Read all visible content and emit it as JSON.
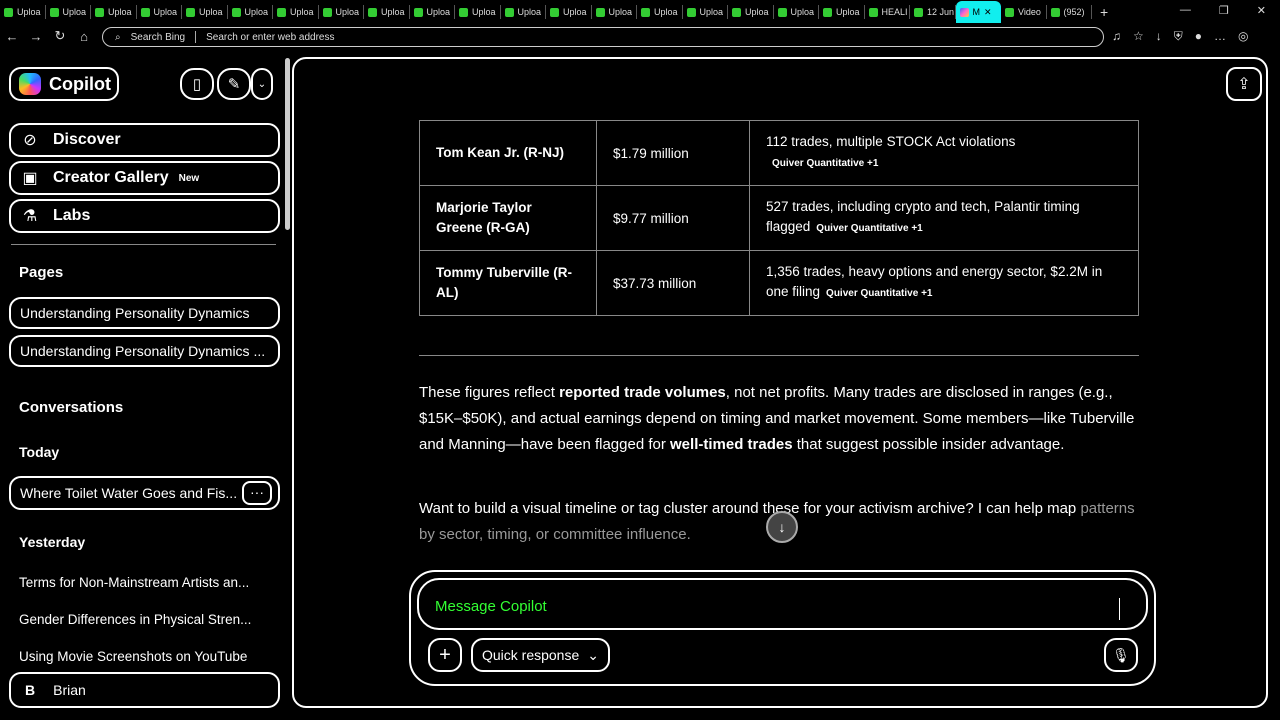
{
  "browser": {
    "tabs": [
      "Uploa",
      "Uploa",
      "Uploa",
      "Uploa",
      "Uploa",
      "Uploa",
      "Uploa",
      "Uploa",
      "Uploa",
      "Uploa",
      "Uploa",
      "Uploa",
      "Uploa",
      "Uploa",
      "Uploa",
      "Uploa",
      "Uploa",
      "Uploa",
      "Uploa",
      "HEALI",
      "12 Jun",
      "M",
      "Video",
      "(952)"
    ],
    "new_tab": "+",
    "search_label": "Search Bing",
    "address_placeholder": "Search or enter web address"
  },
  "sidebar": {
    "brand": "Copilot",
    "nav": [
      {
        "label": "Discover"
      },
      {
        "label": "Creator Gallery",
        "badge": "New"
      },
      {
        "label": "Labs"
      }
    ],
    "pages_heading": "Pages",
    "pages": [
      "Understanding Personality Dynamics",
      "Understanding Personality Dynamics ..."
    ],
    "conversations_heading": "Conversations",
    "today": "Today",
    "today_items": [
      "Where Toilet Water Goes and Fis..."
    ],
    "more": "···",
    "yesterday": "Yesterday",
    "yesterday_items": [
      "Terms for Non-Mainstream Artists an...",
      "Gender Differences in Physical Stren...",
      "Using Movie Screenshots on YouTube"
    ],
    "user": {
      "initial": "B",
      "name": "Brian"
    }
  },
  "table": {
    "rows": [
      {
        "name": "Tom Kean Jr. (R-NJ)",
        "value": "$1.79 million",
        "note": "112 trades, multiple STOCK Act violations",
        "source": "Quiver Quantitative +1"
      },
      {
        "name": "Marjorie Taylor Greene (R-GA)",
        "value": "$9.77 million",
        "note": "527 trades, including crypto and tech, Palantir timing flagged",
        "source": "Quiver Quantitative +1"
      },
      {
        "name": "Tommy Tuberville (R-AL)",
        "value": "$37.73 million",
        "note": "1,356 trades, heavy options and energy sector, $2.2M in one filing",
        "source": "Quiver Quantitative +1"
      }
    ]
  },
  "message": {
    "p1_a": "These figures reflect ",
    "p1_b": "reported trade volumes",
    "p1_c": ", not net profits. Many trades are disclosed in ranges (e.g., $15K–$50K), and actual earnings depend on timing and market movement. Some members—like Tuberville and Manning—have been flagged for ",
    "p1_d": "well-timed trades",
    "p1_e": " that suggest possible insider advantage.",
    "p2_a": "Want to build a visual timeline or tag cluster around these for your activism archive? I can help map ",
    "p2_b": "patterns by sector, timing, or committee influence."
  },
  "composer": {
    "placeholder": "Message Copilot",
    "mode": "Quick response"
  }
}
